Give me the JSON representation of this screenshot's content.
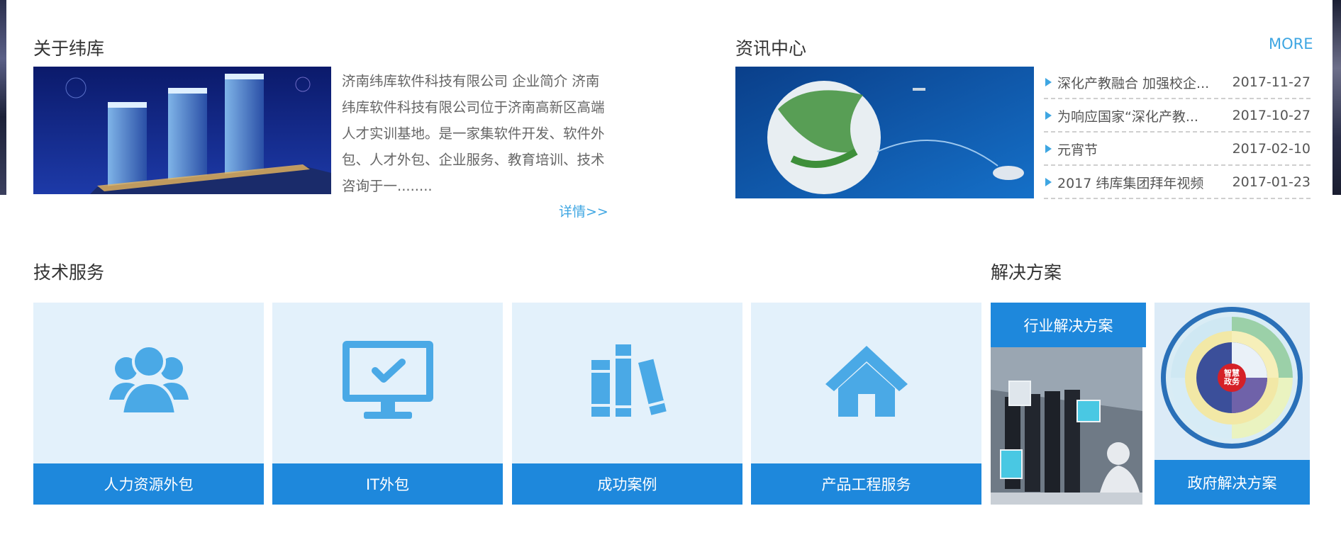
{
  "about": {
    "title": "关于纬库",
    "text": "济南纬库软件科技有限公司 企业简介 济南纬库软件科技有限公司位于济南高新区高端人才实训基地。是一家集软件开发、软件外包、人才外包、企业服务、教育培训、技术咨询于一........",
    "more_label": "详情>>"
  },
  "news": {
    "title": "资讯中心",
    "more_label": "MORE",
    "items": [
      {
        "title": "深化产教融合 加强校企...",
        "date": "2017-11-27"
      },
      {
        "title": "为响应国家“深化产教...",
        "date": "2017-10-27"
      },
      {
        "title": "元宵节",
        "date": "2017-02-10"
      },
      {
        "title": "2017 纬库集团拜年视频",
        "date": "2017-01-23"
      }
    ]
  },
  "tech": {
    "title": "技术服务",
    "items": [
      {
        "label": "人力资源外包",
        "icon": "users-icon"
      },
      {
        "label": "IT外包",
        "icon": "monitor-check-icon"
      },
      {
        "label": "成功案例",
        "icon": "books-icon"
      },
      {
        "label": "产品工程服务",
        "icon": "home-icon"
      }
    ]
  },
  "solutions": {
    "title": "解决方案",
    "industry_label": "行业解决方案",
    "gov_label": "政府解决方案",
    "gov_center_text": "智慧政务"
  },
  "colors": {
    "accent": "#1e88dc",
    "link": "#3ea6e2",
    "tile_bg": "#e3f1fb",
    "icon": "#4aa9e6"
  }
}
